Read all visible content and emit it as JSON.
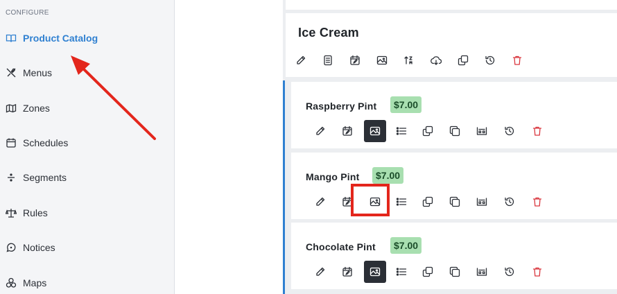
{
  "sidebar": {
    "section_label": "CONFIGURE",
    "items": [
      {
        "label": "Product Catalog",
        "icon": "book-open-icon",
        "active": true
      },
      {
        "label": "Menus",
        "icon": "utensils-icon",
        "active": false
      },
      {
        "label": "Zones",
        "icon": "map-icon",
        "active": false
      },
      {
        "label": "Schedules",
        "icon": "calendar-icon",
        "active": false
      },
      {
        "label": "Segments",
        "icon": "divide-icon",
        "active": false
      },
      {
        "label": "Rules",
        "icon": "scale-icon",
        "active": false
      },
      {
        "label": "Notices",
        "icon": "message-circle-icon",
        "active": false
      },
      {
        "label": "Maps",
        "icon": "shapes-icon",
        "active": false
      }
    ]
  },
  "category": {
    "title": "Ice Cream",
    "toolbar_icons": [
      "pencil-icon",
      "document-icon",
      "calendar-edit-icon",
      "image-icon",
      "sort-icon",
      "cloud-download-icon",
      "copy-icon",
      "history-icon",
      "trash-icon"
    ]
  },
  "products": [
    {
      "name": "Raspberry Pint",
      "price": "$7.00",
      "selected_tool": "image-icon"
    },
    {
      "name": "Mango Pint",
      "price": "$7.00",
      "selected_tool": null
    },
    {
      "name": "Chocolate Pint",
      "price": "$7.00",
      "selected_tool": "image-icon"
    }
  ],
  "product_toolbar_icons": [
    "pencil-icon",
    "calendar-edit-icon",
    "image-icon",
    "list-icon",
    "copy-icon",
    "duplicate-icon",
    "barcode-icon",
    "history-icon",
    "trash-icon"
  ],
  "colors": {
    "accent": "#2f80d1",
    "price_badge": "#a8dfb0",
    "annotation": "#e3261c",
    "trash": "#d9363e"
  }
}
